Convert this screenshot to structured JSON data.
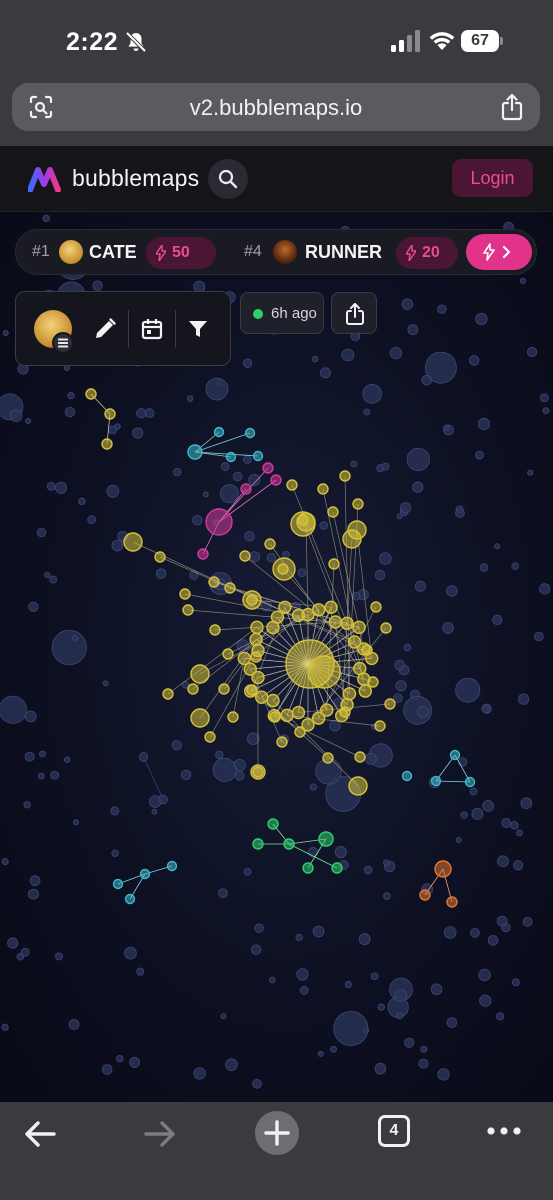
{
  "status_bar": {
    "time": "2:22",
    "battery": "67"
  },
  "browser": {
    "url": "v2.bubblemaps.io",
    "tab_count": "4"
  },
  "header": {
    "brand": "bubblemaps",
    "login_label": "Login"
  },
  "leaderboard": [
    {
      "rank": "#1",
      "name": "CATE",
      "boosts": "50"
    },
    {
      "rank": "#4",
      "name": "RUNNER",
      "boosts": "20"
    }
  ],
  "toolbar": {
    "updated": "6h ago"
  },
  "colors": {
    "accent_pink": "#e2338a",
    "holder_yellow": "#d6c23a",
    "cluster_cyan": "#3fb7c9",
    "cluster_magenta": "#d23a9a",
    "cluster_green": "#2fcf6a",
    "cluster_orange": "#e27530",
    "background_bubble": "#2a3358"
  }
}
